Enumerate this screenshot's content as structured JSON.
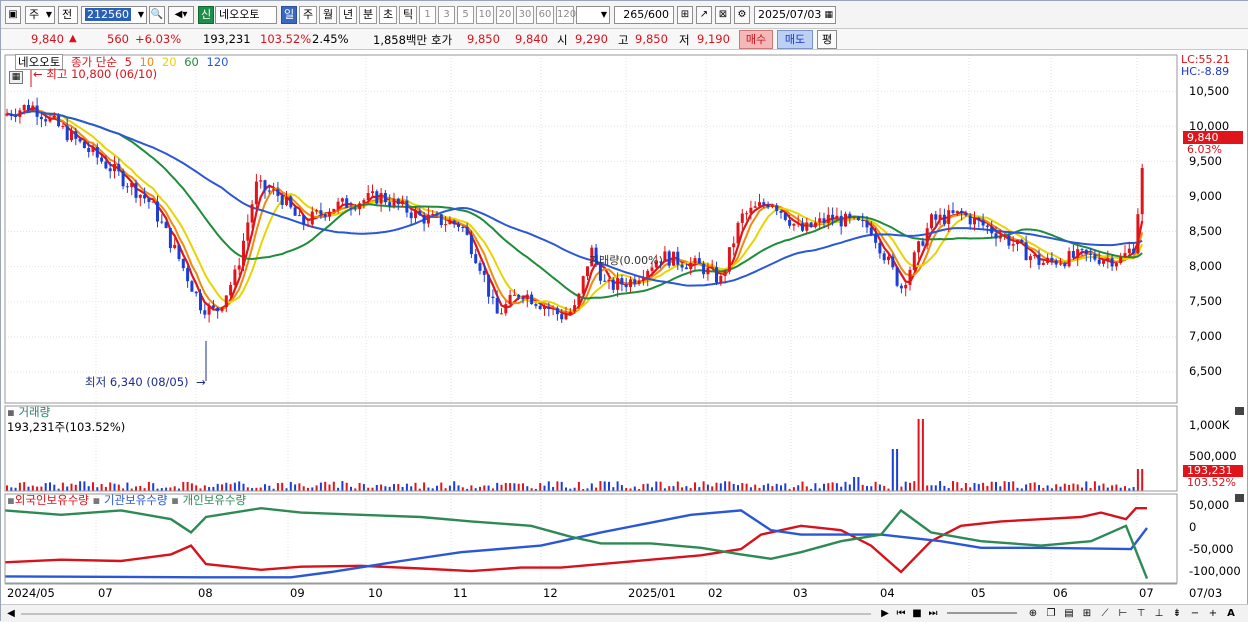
{
  "toolbar": {
    "market_type": "주",
    "adj_type": "전",
    "stock_code": "212560",
    "new_badge": "신",
    "stock_name": "네오오토",
    "periods": [
      "일",
      "주",
      "월",
      "년",
      "분",
      "초",
      "틱"
    ],
    "active_period": "일",
    "intervals": [
      "1",
      "3",
      "5",
      "10",
      "20",
      "30",
      "60",
      "120"
    ],
    "count": "265",
    "count_total": "/600",
    "date": "2025/07/03"
  },
  "quote": {
    "price": "9,840",
    "change_arrow": "▲",
    "change": "560",
    "change_pct": "+6.03%",
    "volume": "193,231",
    "volume_ratio": "103.52%",
    "turnover": "2.45%",
    "amount": "1,858백만",
    "bid_label": "호가",
    "ask": "9,850",
    "bid": "9,840",
    "open_label": "시",
    "open": "9,290",
    "high_label": "고",
    "high": "9,850",
    "low_label": "저",
    "low": "9,190",
    "buy_label": "매수",
    "sell_label": "매도",
    "eval_label": "평"
  },
  "price_pane": {
    "stock_label": "네오오토",
    "ma_title": "종가 단순",
    "ma_periods": [
      {
        "label": "5",
        "color": "#e0151b"
      },
      {
        "label": "10",
        "color": "#f08a0a"
      },
      {
        "label": "20",
        "color": "#e8d400"
      },
      {
        "label": "60",
        "color": "#1f8c3a"
      },
      {
        "label": "120",
        "color": "#2a57d6"
      }
    ],
    "max_note": "최고 10,800 (06/10)",
    "min_note": "최저 6,340 (08/05)",
    "vol_note": "거래량(0.00%)",
    "lc": "LC:55.21",
    "hc": "HC:-8.89",
    "cur_price": "9,840",
    "cur_pct": "6.03%",
    "y_ticks": [
      "10,500",
      "10,000",
      "9,500",
      "9,000",
      "8,500",
      "8,000",
      "7,500",
      "7,000",
      "6,500"
    ],
    "colors": {
      "up": "#e0151b",
      "down": "#1b3fd6"
    }
  },
  "volume_pane": {
    "title": "거래량",
    "value": "193,231주(103.52%)",
    "y_ticks": [
      "1,000K",
      "500,000"
    ],
    "cur": "193,231",
    "cur_pct": "103.52%"
  },
  "holding_pane": {
    "series": [
      {
        "name": "외국인보유수량",
        "color": "#d8121b"
      },
      {
        "name": "기관보유수량",
        "color": "#2a57d6"
      },
      {
        "name": "개인보유수량",
        "color": "#2e8a55"
      }
    ],
    "y_ticks": [
      "50,000",
      "0",
      "-50,000",
      "-100,000"
    ]
  },
  "x_axis": {
    "labels": [
      "2024/05",
      "07",
      "08",
      "09",
      "10",
      "11",
      "12",
      "2025/01",
      "02",
      "03",
      "04",
      "05",
      "06",
      "07"
    ],
    "right_label": "07/03"
  }
}
